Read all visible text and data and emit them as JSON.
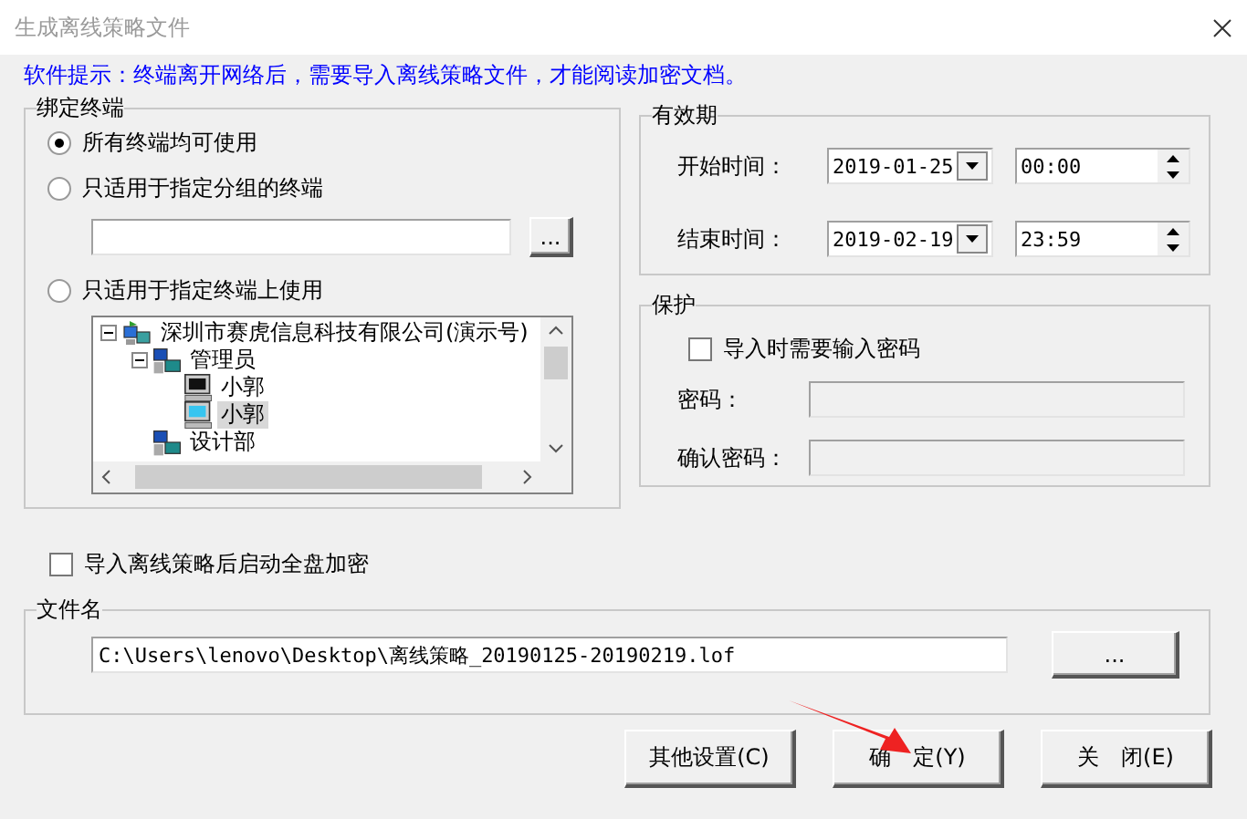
{
  "window": {
    "title": "生成离线策略文件"
  },
  "hint": "软件提示：终端离开网络后，需要导入离线策略文件，才能阅读加密文档。",
  "bind_group": {
    "legend": "绑定终端",
    "options": [
      {
        "label": "所有终端均可使用",
        "selected": true
      },
      {
        "label": "只适用于指定分组的终端",
        "selected": false
      },
      {
        "label": "只适用于指定终端上使用",
        "selected": false
      }
    ],
    "group_browse": "...",
    "tree": [
      {
        "kind": "org",
        "label": "深圳市赛虎信息科技有限公司(演示号)",
        "expanded": true,
        "selected": false,
        "children": [
          {
            "kind": "group",
            "label": "管理员",
            "expanded": true,
            "selected": false,
            "children": [
              {
                "kind": "pc",
                "label": "小郭",
                "online": false,
                "selected": false
              },
              {
                "kind": "pc",
                "label": "小郭",
                "online": true,
                "selected": true
              }
            ]
          },
          {
            "kind": "group",
            "label": "设计部",
            "selected": false
          }
        ]
      }
    ]
  },
  "validity": {
    "legend": "有效期",
    "rows": [
      {
        "label": "开始时间：",
        "date": "2019-01-25",
        "time": "00:00"
      },
      {
        "label": "结束时间：",
        "date": "2019-02-19",
        "time": "23:59"
      }
    ]
  },
  "protect": {
    "legend": "保护",
    "require_password": {
      "label": "导入时需要输入密码",
      "checked": false
    },
    "password_label": "密码：",
    "confirm_label": "确认密码：",
    "disabled": true
  },
  "full_disk": {
    "label": "导入离线策略后启动全盘加密",
    "checked": false
  },
  "file": {
    "legend": "文件名",
    "path": "C:\\Users\\lenovo\\Desktop\\离线策略_20190125-20190219.lof",
    "browse": "..."
  },
  "buttons": [
    "其他设置(C)",
    "确　定(Y)",
    "关　闭(E)"
  ]
}
